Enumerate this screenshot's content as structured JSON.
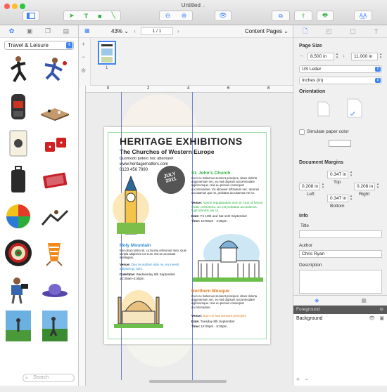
{
  "window": {
    "title": "Untitled"
  },
  "colors": {
    "accent": "#3d83f5",
    "green": "#2cae3c",
    "orange": "#e07a1a"
  },
  "left_panel": {
    "category": "Travel & Leisure",
    "search_placeholder": "Search",
    "clips": [
      "runner",
      "soccer-player",
      "backpack",
      "chess-board",
      "playing-card",
      "dice",
      "luggage",
      "card-deck",
      "beach-ball",
      "climber",
      "dartboard",
      "beach-chair",
      "camera-man",
      "hat",
      "golfer",
      "golfer-2"
    ]
  },
  "center": {
    "zoom": "43%",
    "page_indicator": "1 / 1",
    "view_mode": "Content Pages",
    "thumb_number": "1",
    "ruler_labels": [
      "0",
      "2",
      "4",
      "6",
      "8"
    ],
    "document": {
      "title": "HERITAGE EXHIBITIONS",
      "subtitle": "The Churches of Western Europe",
      "intro": "Quomodo potero hoc attentare!",
      "website": "www.heritagematters.com",
      "phone": "0123 456 7890",
      "badge_line1": "JULY",
      "badge_line2": "2011",
      "sections": [
        {
          "heading": "St. John's Church",
          "body": "Cum ne habemus sensent principes, sitam dolorta argumentum nec, eu sed dopsum accommodare sigiferumque. Has eu persius consequat accommodare. Vix aboevier inftmatum nec. Verendi accusamus quo ne, probatus accusamus mei ut.",
          "venue_label": "Venue:",
          "venue": "Aperin repudiandae eum te. Duo id harum oratio consetetur, an est probatus accusamus, fugit lobortis per ut.",
          "date_label": "Date:",
          "date": "Fri 10th and Sat 11th September",
          "time_label": "Time:",
          "time": "10:00am - 4:00pm"
        },
        {
          "heading": "Holy Mountain",
          "body": "Eos dicat nostro sit, cu lacinia referuntur mea. Quis scripta adipiscen ius eum. Est an accusata intellegam.",
          "venue_label": "Venue:",
          "venue": "Quo te audiam iatis no, eu invenit adipiscing, nam.",
          "date_label": "Date/time:",
          "date": "Wednesday 8th September 10:30am-4:30pm"
        },
        {
          "heading": "Northern Mosque",
          "body": "Cum ne habemus sensent principes, sitam dolorta argumentum nec, eu sed dopsum accommodare sigiferumque. Has eu persius consequat accommodare.",
          "venue_label": "Venue:",
          "venue": "Eum ne has sensent principes",
          "date_label": "Date:",
          "date": "Tuesday 8th September",
          "time_label": "Time:",
          "time": "12:00pm - 5:00pm"
        }
      ]
    }
  },
  "right_panel": {
    "page_size_label": "Page Size",
    "width": "8.500 in",
    "height": "11.000 in",
    "paper": "US Letter",
    "units": "Inches (in)",
    "orientation_label": "Orientation",
    "simulate_paper_label": "Simulate paper color",
    "margins_label": "Document Margins",
    "margin_top": "0.347 in",
    "margin_left": "0.208 in",
    "margin_right": "0.208 in",
    "margin_bottom": "0.347 in",
    "top_label": "Top",
    "left_label": "Left",
    "right_label": "Right",
    "bottom_label": "Bottom",
    "info_label": "Info",
    "title_label": "Title",
    "author_label": "Author",
    "author": "Chris Ryan",
    "description_label": "Description",
    "layers_header": "Foreground",
    "layer_name": "Background"
  }
}
